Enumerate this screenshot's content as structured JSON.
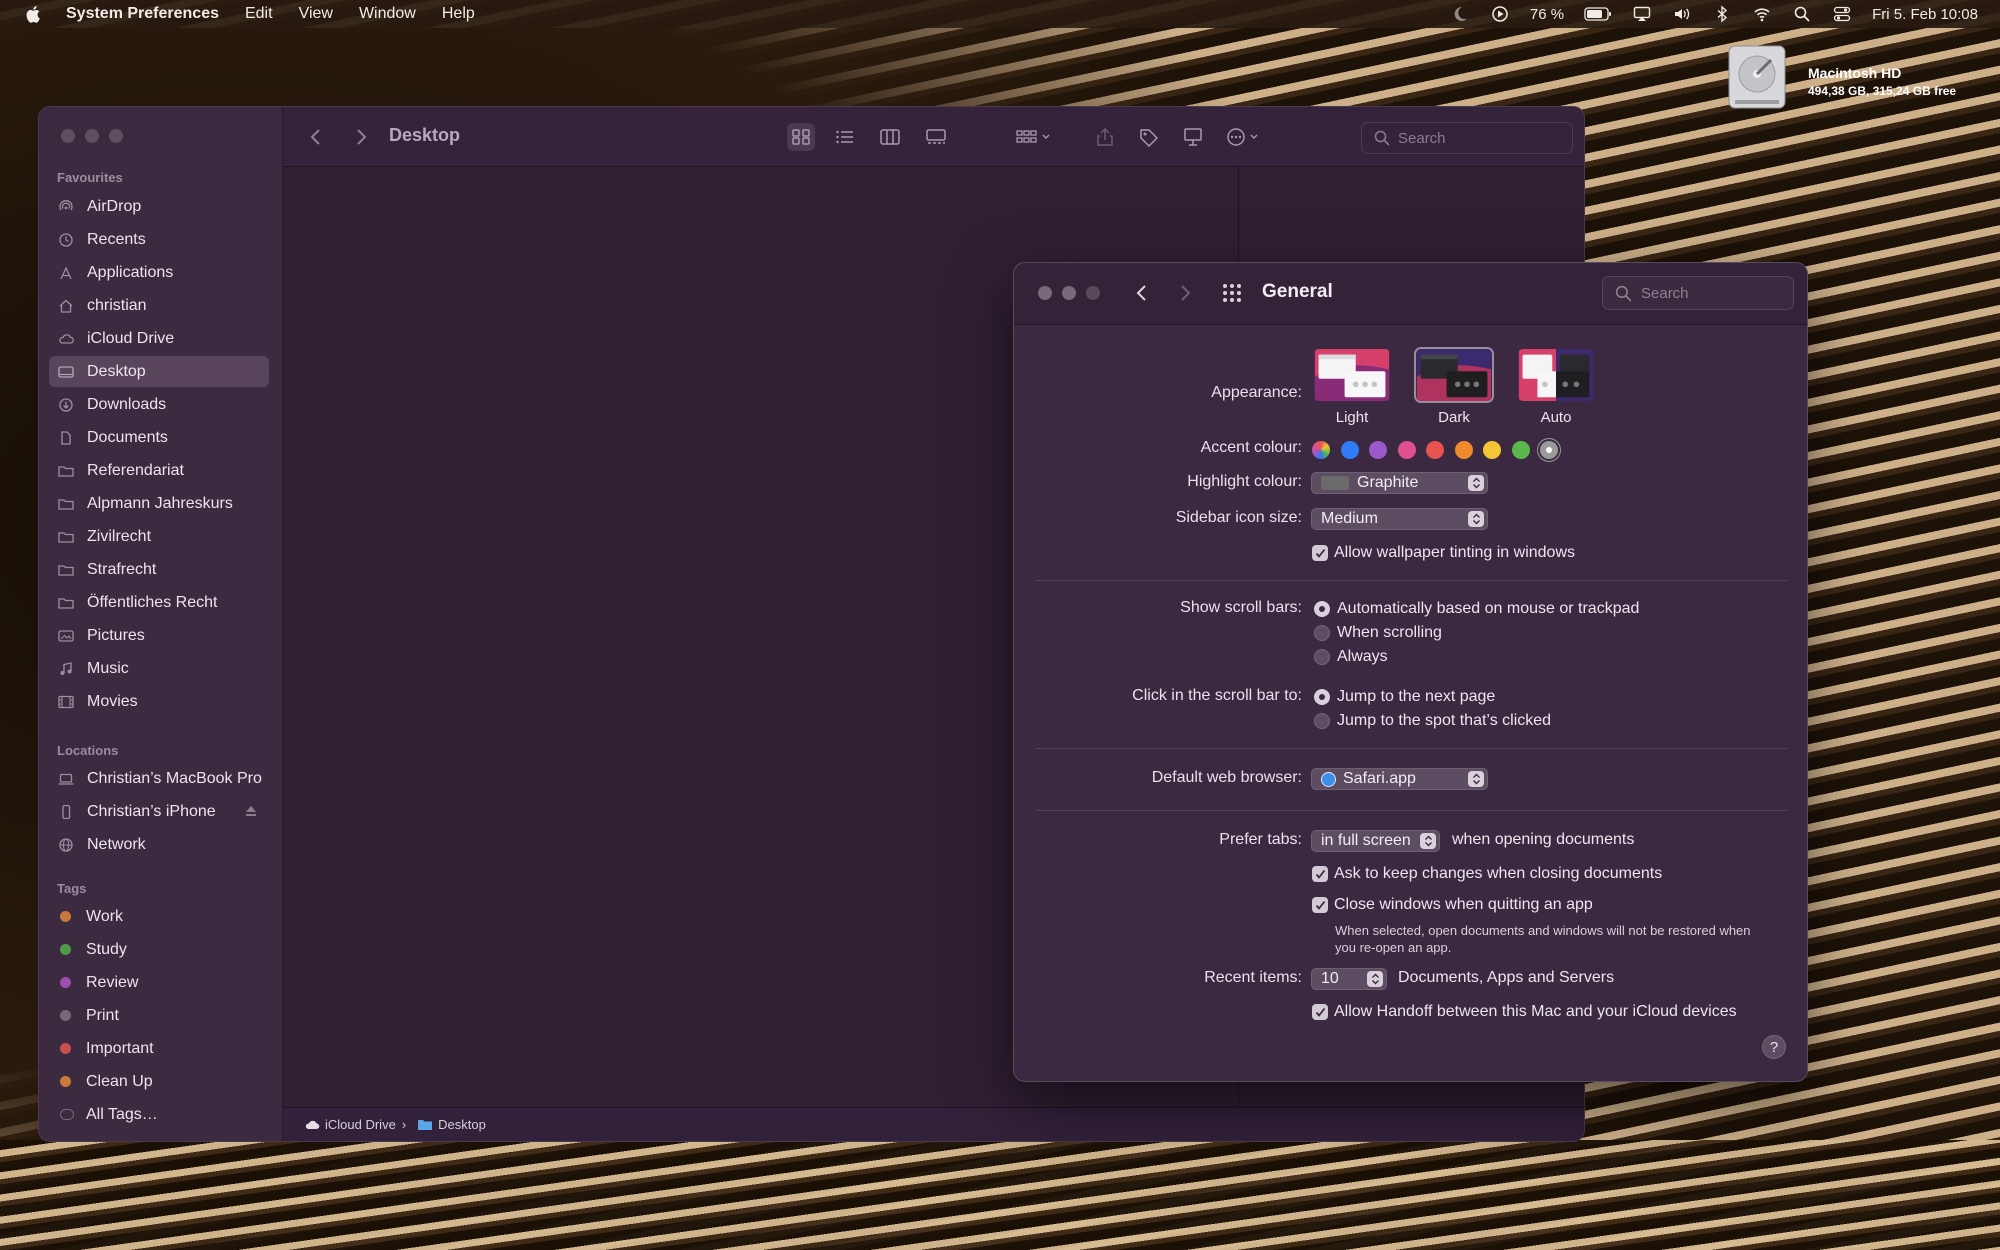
{
  "menubar": {
    "app_name": "System Preferences",
    "menus": [
      "Edit",
      "View",
      "Window",
      "Help"
    ],
    "battery": "76 %",
    "clock": "Fri 5. Feb  10:08"
  },
  "desktop": {
    "disk_name": "Macintosh HD",
    "disk_info": "494,38 GB, 315,24 GB free"
  },
  "finder": {
    "title": "Desktop",
    "search_placeholder": "Search",
    "favourites_heading": "Favourites",
    "favourites": [
      "AirDrop",
      "Recents",
      "Applications",
      "christian",
      "iCloud Drive",
      "Desktop",
      "Downloads",
      "Documents",
      "Referendariat",
      "Alpmann Jahreskurs",
      "Zivilrecht",
      "Strafrecht",
      "Öffentliches Recht",
      "Pictures",
      "Music",
      "Movies"
    ],
    "selected_favourite": "Desktop",
    "locations_heading": "Locations",
    "locations": [
      "Christian’s MacBook Pro",
      "Christian’s iPhone",
      "Network"
    ],
    "tags_heading": "Tags",
    "tags": [
      {
        "label": "Work",
        "color": "#c97a3a"
      },
      {
        "label": "Study",
        "color": "#4f9b4a"
      },
      {
        "label": "Review",
        "color": "#9c4fb0"
      },
      {
        "label": "Print",
        "color": "#77687a"
      },
      {
        "label": "Important",
        "color": "#c8504f"
      },
      {
        "label": "Clean Up",
        "color": "#c97a3a"
      },
      {
        "label": "All Tags…",
        "color": ""
      }
    ],
    "path_root": "iCloud Drive",
    "path_separator": "›",
    "path_leaf": "Desktop"
  },
  "prefs": {
    "title": "General",
    "search_placeholder": "Search",
    "appearance_label": "Appearance:",
    "appearance_options": [
      "Light",
      "Dark",
      "Auto"
    ],
    "appearance_selected": "Dark",
    "accent_label": "Accent colour:",
    "accent_colors": [
      "#multicolor",
      "#2f7cf6",
      "#9b59c9",
      "#e0508e",
      "#e7534f",
      "#f08a2e",
      "#f4c534",
      "#5cb84e",
      "#9a9a9a"
    ],
    "accent_selected_index": 8,
    "highlight_label": "Highlight colour:",
    "highlight_value": "Graphite",
    "sidebar_size_label": "Sidebar icon size:",
    "sidebar_size_value": "Medium",
    "wallpaper_tinting": "Allow wallpaper tinting in windows",
    "scroll_label": "Show scroll bars:",
    "scroll_options": [
      "Automatically based on mouse or trackpad",
      "When scrolling",
      "Always"
    ],
    "scroll_selected": 0,
    "click_label": "Click in the scroll bar to:",
    "click_options": [
      "Jump to the next page",
      "Jump to the spot that’s clicked"
    ],
    "click_selected": 0,
    "browser_label": "Default web browser:",
    "browser_value": "Safari.app",
    "tabs_label": "Prefer tabs:",
    "tabs_value": "in full screen",
    "tabs_suffix": "when opening documents",
    "ask_keep": "Ask to keep changes when closing documents",
    "close_windows": "Close windows when quitting an app",
    "close_note": "When selected, open documents and windows will not be restored when you re-open an app.",
    "recent_label": "Recent items:",
    "recent_value": "10",
    "recent_suffix": "Documents, Apps and Servers",
    "handoff": "Allow Handoff between this Mac and your iCloud devices",
    "help": "?"
  }
}
